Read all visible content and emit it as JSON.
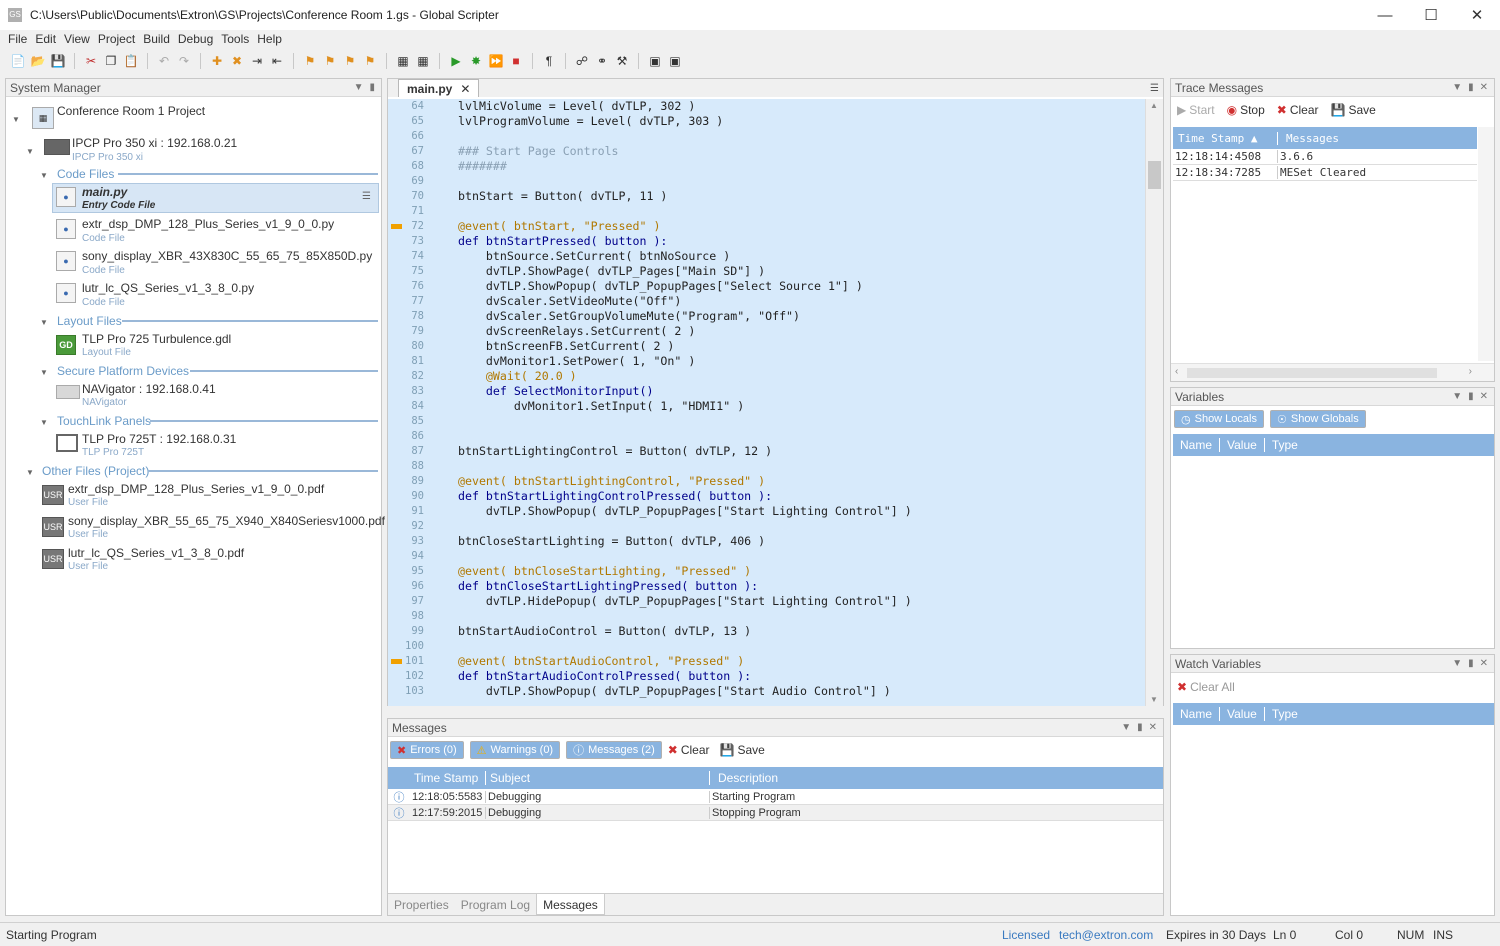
{
  "window": {
    "title": "C:\\Users\\Public\\Documents\\Extron\\GS\\Projects\\Conference Room 1.gs - Global Scripter",
    "app_icon": "GS"
  },
  "menu": [
    "File",
    "Edit",
    "View",
    "Project",
    "Build",
    "Debug",
    "Tools",
    "Help"
  ],
  "system_manager": {
    "title": "System Manager",
    "project": "Conference Room 1 Project",
    "controller": {
      "name": "IPCP Pro 350 xi : 192.168.0.21",
      "type": "IPCP Pro 350 xi"
    },
    "code_files_label": "Code Files",
    "code_files": [
      {
        "name": "main.py",
        "type": "Entry Code File"
      },
      {
        "name": "extr_dsp_DMP_128_Plus_Series_v1_9_0_0.py",
        "type": "Code File"
      },
      {
        "name": "sony_display_XBR_43X830C_55_65_75_85X850D.py",
        "type": "Code File"
      },
      {
        "name": "lutr_lc_QS_Series_v1_3_8_0.py",
        "type": "Code File"
      }
    ],
    "layout_files_label": "Layout Files",
    "layout_file": {
      "name": "TLP Pro 725 Turbulence.gdl",
      "type": "Layout File",
      "icon": "GD"
    },
    "secure_label": "Secure Platform Devices",
    "navigator": {
      "name": "NAVigator : 192.168.0.41",
      "type": "NAVigator"
    },
    "touchlink_label": "TouchLink Panels",
    "tlp": {
      "name": "TLP Pro 725T : 192.168.0.31",
      "type": "TLP Pro 725T"
    },
    "other_label": "Other Files (Project)",
    "other_files": [
      {
        "name": "extr_dsp_DMP_128_Plus_Series_v1_9_0_0.pdf",
        "type": "User File",
        "icon": "USR"
      },
      {
        "name": "sony_display_XBR_55_65_75_X940_X840Seriesv1000.pdf",
        "type": "User File",
        "icon": "USR"
      },
      {
        "name": "lutr_lc_QS_Series_v1_3_8_0.pdf",
        "type": "User File",
        "icon": "USR"
      }
    ]
  },
  "editor": {
    "tab": "main.py",
    "lines": [
      {
        "n": "64",
        "code": "lvlMicVolume = Level( dvTLP, 302 )"
      },
      {
        "n": "65",
        "code": "lvlProgramVolume = Level( dvTLP, 303 )"
      },
      {
        "n": "66",
        "code": ""
      },
      {
        "n": "67",
        "code": "### Start Page Controls"
      },
      {
        "n": "68",
        "code": "#######"
      },
      {
        "n": "69",
        "code": ""
      },
      {
        "n": "70",
        "code": "btnStart = Button( dvTLP, 11 )"
      },
      {
        "n": "71",
        "code": ""
      },
      {
        "n": "72",
        "code": "@event( btnStart, \"Pressed\" )"
      },
      {
        "n": "73",
        "code": "def btnStartPressed( button ):"
      },
      {
        "n": "74",
        "code": "    btnSource.SetCurrent( btnNoSource )"
      },
      {
        "n": "75",
        "code": "    dvTLP.ShowPage( dvTLP_Pages[\"Main SD\"] )"
      },
      {
        "n": "76",
        "code": "    dvTLP.ShowPopup( dvTLP_PopupPages[\"Select Source 1\"] )"
      },
      {
        "n": "77",
        "code": "    dvScaler.SetVideoMute(\"Off\")"
      },
      {
        "n": "78",
        "code": "    dvScaler.SetGroupVolumeMute(\"Program\", \"Off\")"
      },
      {
        "n": "79",
        "code": "    dvScreenRelays.SetCurrent( 2 )"
      },
      {
        "n": "80",
        "code": "    btnScreenFB.SetCurrent( 2 )"
      },
      {
        "n": "81",
        "code": "    dvMonitor1.SetPower( 1, \"On\" )"
      },
      {
        "n": "82",
        "code": "    @Wait( 20.0 )"
      },
      {
        "n": "83",
        "code": "    def SelectMonitorInput()"
      },
      {
        "n": "84",
        "code": "        dvMonitor1.SetInput( 1, \"HDMI1\" )"
      },
      {
        "n": "85",
        "code": ""
      },
      {
        "n": "86",
        "code": ""
      },
      {
        "n": "87",
        "code": "btnStartLightingControl = Button( dvTLP, 12 )"
      },
      {
        "n": "88",
        "code": ""
      },
      {
        "n": "89",
        "code": "@event( btnStartLightingControl, \"Pressed\" )"
      },
      {
        "n": "90",
        "code": "def btnStartLightingControlPressed( button ):"
      },
      {
        "n": "91",
        "code": "    dvTLP.ShowPopup( dvTLP_PopupPages[\"Start Lighting Control\"] )"
      },
      {
        "n": "92",
        "code": ""
      },
      {
        "n": "93",
        "code": "btnCloseStartLighting = Button( dvTLP, 406 )"
      },
      {
        "n": "94",
        "code": ""
      },
      {
        "n": "95",
        "code": "@event( btnCloseStartLighting, \"Pressed\" )"
      },
      {
        "n": "96",
        "code": "def btnCloseStartLightingPressed( button ):"
      },
      {
        "n": "97",
        "code": "    dvTLP.HidePopup( dvTLP_PopupPages[\"Start Lighting Control\"] )"
      },
      {
        "n": "98",
        "code": ""
      },
      {
        "n": "99",
        "code": "btnStartAudioControl = Button( dvTLP, 13 )"
      },
      {
        "n": "100",
        "code": ""
      },
      {
        "n": "101",
        "code": "@event( btnStartAudioControl, \"Pressed\" )"
      },
      {
        "n": "102",
        "code": "def btnStartAudioControlPressed( button ):"
      },
      {
        "n": "103",
        "code": "    dvTLP.ShowPopup( dvTLP_PopupPages[\"Start Audio Control\"] )"
      }
    ],
    "markers": [
      "72",
      "101"
    ]
  },
  "messages": {
    "title": "Messages",
    "errors": "Errors (0)",
    "warnings": "Warnings (0)",
    "messages": "Messages (2)",
    "clear": "Clear",
    "save": "Save",
    "columns": [
      "Time Stamp",
      "Subject",
      "Description"
    ],
    "rows": [
      {
        "time": "12:18:05:5583",
        "subject": "Debugging",
        "desc": "Starting Program"
      },
      {
        "time": "12:17:59:2015",
        "subject": "Debugging",
        "desc": "Stopping Program"
      }
    ],
    "tabs": [
      "Properties",
      "Program Log",
      "Messages"
    ]
  },
  "trace": {
    "title": "Trace Messages",
    "start": "Start",
    "stop": "Stop",
    "clear": "Clear",
    "save": "Save",
    "columns": [
      "Time Stamp",
      "Messages"
    ],
    "rows": [
      {
        "time": "12:18:14:4508",
        "msg": "3.6.6"
      },
      {
        "time": "12:18:34:7285",
        "msg": "MESet Cleared"
      }
    ]
  },
  "variables": {
    "title": "Variables",
    "show_locals": "Show Locals",
    "show_globals": "Show Globals",
    "columns": [
      "Name",
      "Value",
      "Type"
    ]
  },
  "watch": {
    "title": "Watch Variables",
    "clear_all": "Clear All",
    "columns": [
      "Name",
      "Value",
      "Type"
    ]
  },
  "statusbar": {
    "left": "Starting Program",
    "licensed": "Licensed",
    "email": "tech@extron.com",
    "expires": "Expires in 30 Days",
    "ln": "Ln 0",
    "col": "Col 0",
    "num": "NUM",
    "ins": "INS"
  },
  "colors": {
    "accent": "#8ab4e0",
    "editor_bg": "#d7eafb",
    "marker": "#f0a000",
    "keyword": "#00008b",
    "string": "#a31515"
  }
}
